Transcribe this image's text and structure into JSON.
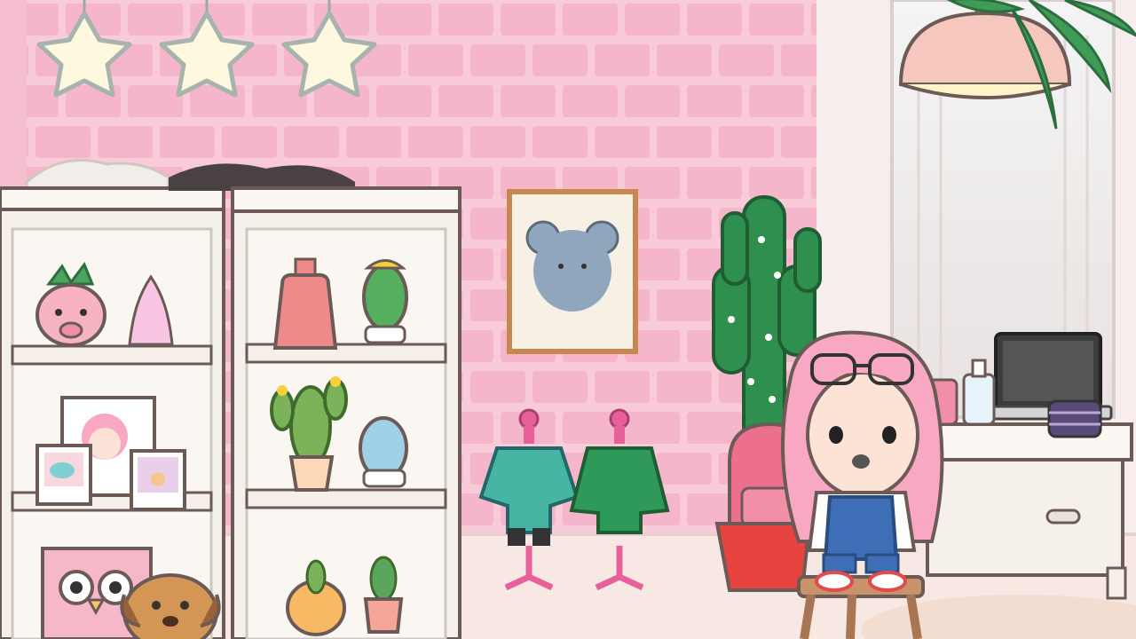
{
  "scene": {
    "title": "",
    "room": "bedroom"
  },
  "hud": {
    "stars": [
      {
        "name": "star-1",
        "state": "empty"
      },
      {
        "name": "star-2",
        "state": "empty"
      },
      {
        "name": "star-3",
        "state": "empty"
      }
    ]
  },
  "palette": {
    "wall_pink": "#f8c9d8",
    "brick_pink": "#f4b3c9",
    "floor": "#f7e9e6",
    "shelf": "#f5f0ea",
    "outline": "#6b5a55",
    "accent_green": "#3f9b57",
    "hair_pink": "#f8a8c3"
  },
  "objects": [
    {
      "id": "left-shelf",
      "type": "furniture"
    },
    {
      "id": "right-shelf",
      "type": "furniture"
    },
    {
      "id": "mouse-poster",
      "type": "wall-art"
    },
    {
      "id": "cactus-lights",
      "type": "plant"
    },
    {
      "id": "mannequin-teal",
      "type": "clothing"
    },
    {
      "id": "mannequin-green",
      "type": "clothing"
    },
    {
      "id": "pink-backpack",
      "type": "item"
    },
    {
      "id": "character",
      "type": "character"
    },
    {
      "id": "stool",
      "type": "furniture"
    },
    {
      "id": "desk",
      "type": "furniture"
    },
    {
      "id": "laptop",
      "type": "item"
    },
    {
      "id": "ceiling-lamp",
      "type": "light"
    },
    {
      "id": "dog",
      "type": "pet"
    },
    {
      "id": "owl-box",
      "type": "storage"
    }
  ]
}
